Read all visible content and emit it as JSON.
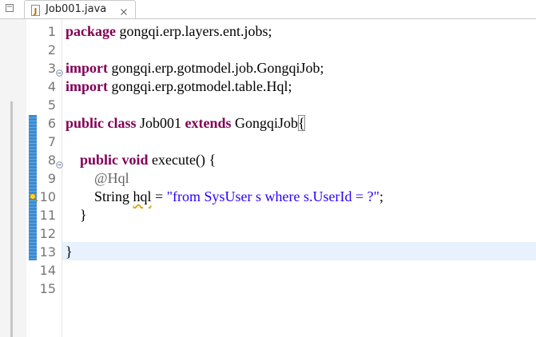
{
  "tab": {
    "label": "Job001.java",
    "icon": "java-file-icon",
    "close_icon": "close-icon"
  },
  "editor": {
    "lines": [
      {
        "num": "1",
        "tokens": [
          {
            "t": "package",
            "c": "kw"
          },
          {
            "t": " gongqi.erp.layers.ent.jobs;",
            "c": ""
          }
        ]
      },
      {
        "num": "2",
        "tokens": []
      },
      {
        "num": "3",
        "tokens": [
          {
            "t": "import",
            "c": "kw"
          },
          {
            "t": " gongqi.erp.gotmodel.job.GongqiJob;",
            "c": ""
          }
        ]
      },
      {
        "num": "4",
        "tokens": [
          {
            "t": "import",
            "c": "kw"
          },
          {
            "t": " gongqi.erp.gotmodel.table.Hql;",
            "c": ""
          }
        ]
      },
      {
        "num": "5",
        "tokens": []
      },
      {
        "num": "6",
        "tokens": [
          {
            "t": "public",
            "c": "kw"
          },
          {
            "t": " ",
            "c": ""
          },
          {
            "t": "class",
            "c": "kw"
          },
          {
            "t": " Job001 ",
            "c": ""
          },
          {
            "t": "extends",
            "c": "kw"
          },
          {
            "t": " GongqiJob",
            "c": ""
          },
          {
            "t": "{",
            "c": "bracket"
          }
        ]
      },
      {
        "num": "7",
        "tokens": []
      },
      {
        "num": "8",
        "tokens": [
          {
            "t": "    ",
            "c": ""
          },
          {
            "t": "public",
            "c": "kw"
          },
          {
            "t": " ",
            "c": ""
          },
          {
            "t": "void",
            "c": "kw"
          },
          {
            "t": " execute() {",
            "c": ""
          }
        ]
      },
      {
        "num": "9",
        "tokens": [
          {
            "t": "        ",
            "c": ""
          },
          {
            "t": "@Hql",
            "c": "ann"
          }
        ]
      },
      {
        "num": "10",
        "tokens": [
          {
            "t": "        String ",
            "c": ""
          },
          {
            "t": "hql",
            "c": "warn"
          },
          {
            "t": " = ",
            "c": ""
          },
          {
            "t": "\"from SysUser s where s.UserId = ?\"",
            "c": "str"
          },
          {
            "t": ";",
            "c": ""
          }
        ]
      },
      {
        "num": "11",
        "tokens": [
          {
            "t": "    }",
            "c": ""
          }
        ]
      },
      {
        "num": "12",
        "tokens": []
      },
      {
        "num": "13",
        "tokens": [
          {
            "t": "}",
            "c": ""
          }
        ]
      },
      {
        "num": "14",
        "tokens": []
      },
      {
        "num": "15",
        "tokens": []
      }
    ],
    "fold_lines": [
      "3",
      "8"
    ],
    "warning_line": "10",
    "current_line": "13"
  },
  "colors": {
    "keyword": "#7f0055",
    "string": "#2a00ff",
    "annotation": "#646464",
    "current_line_bg": "#e8f2fe",
    "change_bar": "#3b8ad0"
  }
}
